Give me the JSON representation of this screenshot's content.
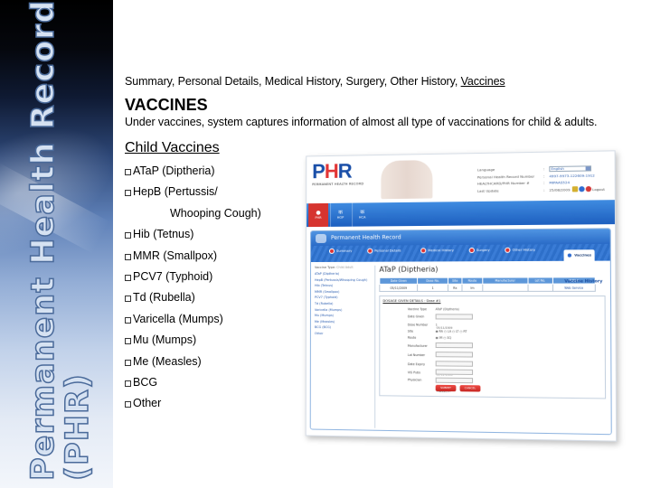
{
  "side_title": {
    "line1": "Permanent Health Record",
    "line2": "(PHR)"
  },
  "breadcrumb": {
    "items": [
      "Summary, ",
      "Personal Details, ",
      "Medical History, ",
      "Surgery, ",
      "Other History, "
    ],
    "current": "Vaccines"
  },
  "page_title": "VACCINES",
  "description": "Under vaccines, system captures information of almost all type of vaccinations for child & adults.",
  "section_title": "Child Vaccines",
  "vaccines": [
    "ATaP (Diptheria)",
    "HepB (Pertussis/",
    "Whooping Cough)",
    "Hib (Tetnus)",
    "MMR (Smallpox)",
    "PCV7 (Typhoid)",
    "Td (Rubella)",
    "Varicella (Mumps)",
    "Mu (Mumps)",
    "Me (Measles)",
    "BCG",
    "Other"
  ],
  "app": {
    "logo": {
      "text_p": "P",
      "text_h": "H",
      "text_r": "R",
      "subtitle": "PERMANENT HEALTH RECORD"
    },
    "user_info": {
      "language_label": "Language",
      "language_value": "English",
      "phr_number_label": "Personal Health Record Number",
      "phr_number_value": "4997-9973-122609-1912",
      "health_card_label": "HEALTHCARD/PHR Number #",
      "health_card_value": "MIPAAS524",
      "last_update_label": "Last Update",
      "last_update_value": "25/08/2009",
      "logout_label": "Logout"
    },
    "top_nav": [
      {
        "label": "PHR",
        "active": true
      },
      {
        "label": "HOP",
        "active": false
      },
      {
        "label": "HCA",
        "active": false
      }
    ],
    "panel_title": "Permanent Health Record",
    "section_tabs": [
      {
        "label": "Summary",
        "active": false
      },
      {
        "label": "Personal Details",
        "active": false
      },
      {
        "label": "Medical History",
        "active": false
      },
      {
        "label": "Surgery",
        "active": false
      },
      {
        "label": "Other History",
        "active": false
      },
      {
        "label": "Vaccines",
        "active": true
      }
    ],
    "vaccine_type": {
      "label": "Vaccine Type:",
      "option1": "Child",
      "option2": "Adult"
    },
    "sidebar_vaccines": [
      "ATaP (Diptheria)",
      "HepB (Pertussis/Whooping Cough)",
      "Hib (Tetnus)",
      "MMR (Smallpox)",
      "PCV7 (Typhoid)",
      "Td (Rubella)",
      "Varicella (Mumps)",
      "Mu (Mumps)",
      "Me (Measles)",
      "BCG (BCG)",
      "Other"
    ],
    "vaccine_title": "ATaP (Diptheria)",
    "vaccine_history_link": "Vaccine History",
    "dose_table": {
      "headers": [
        "Date Given",
        "Dose No.",
        "Site",
        "Route",
        "Manufacturer",
        "Lot No.",
        "Action"
      ],
      "row": [
        "05/11/2009",
        "1",
        "Rx",
        "Im",
        "",
        "",
        "Web Service"
      ]
    },
    "dose_details": {
      "heading": "DOSAGE GIVEN DETAILS : Dose #1",
      "fields": [
        {
          "label": "Vaccine Type",
          "value": "ATaP (Diptheria)"
        },
        {
          "label": "Date Given",
          "value": "05/11/2009"
        },
        {
          "label": "Dose Number",
          "value": "1"
        },
        {
          "label": "Site",
          "value": ""
        },
        {
          "label": "Route",
          "value": ""
        },
        {
          "label": "Manufacturer",
          "value": ""
        },
        {
          "label": "Lot Number",
          "value": ""
        },
        {
          "label": "Date Expiry",
          "value": "01-12-2010"
        },
        {
          "label": "VIS Pubs",
          "value": ""
        },
        {
          "label": "Physician",
          "value": "--SELECT--"
        }
      ],
      "site_options": [
        "RA",
        "LA",
        "LT",
        "RT"
      ],
      "route_options": [
        "IM",
        "SQ"
      ],
      "submit_label": "SUBMIT",
      "cancel_label": "CANCEL"
    }
  }
}
